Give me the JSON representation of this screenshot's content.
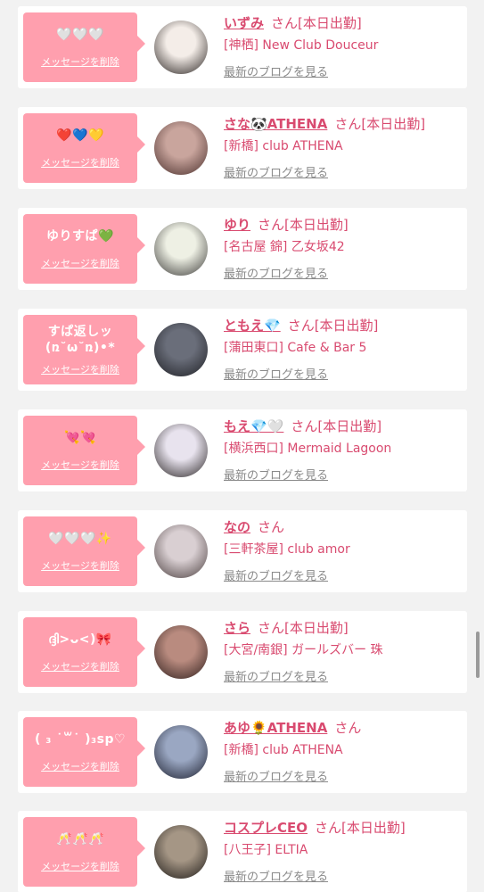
{
  "delete_label": "メッセージを削除",
  "blog_label": "最新のブログを見る",
  "san_label": "さん",
  "cards": [
    {
      "message": "🤍🤍🤍",
      "name": "いずみ",
      "status": "[本日出勤]",
      "shop": "[神栖] New Club Douceur"
    },
    {
      "message": "❤️💙💛",
      "name": "さな🐼ATHENA",
      "status": "[本日出勤]",
      "shop": "[新橋] club ATHENA"
    },
    {
      "message": "ゆりすぱ💚",
      "name": "ゆり",
      "status": "[本日出勤]",
      "shop": "[名古屋 錦] 乙女坂42"
    },
    {
      "message": "すぱ返しッ(ռ˘ω˘ռ)•*",
      "name": "ともえ💎",
      "status": "[本日出勤]",
      "shop": "[蒲田東口] Cafe & Bar 5"
    },
    {
      "message": "💘💘",
      "name": "もえ💎🤍",
      "status": "[本日出勤]",
      "shop": "[横浜西口] Mermaid Lagoon"
    },
    {
      "message": "🤍🤍🤍✨",
      "name": "なの",
      "status": "",
      "shop": "[三軒茶屋] club amor"
    },
    {
      "message": "ദ്ദി>ᴗ<)🎀",
      "name": "さら",
      "status": "[本日出勤]",
      "shop": "[大宮/南銀] ガールズバー 珠"
    },
    {
      "message": "( ₃ ˙꒳˙ )₃sp♡",
      "name": "あゆ🌻ATHENA",
      "status": "",
      "shop": "[新橋] club ATHENA"
    },
    {
      "message": "🥂🥂🥂",
      "name": "コスプレCEO",
      "status": "[本日出勤]",
      "shop": "[八王子] ELTIA"
    }
  ],
  "avatar_colors": [
    [
      "#f4ede8",
      "#2a2422"
    ],
    [
      "#c9a59d",
      "#4a2f2c"
    ],
    [
      "#eef0e4",
      "#3b3a38"
    ],
    [
      "#6a6e7a",
      "#1e1f24"
    ],
    [
      "#e8e3ee",
      "#2b2626"
    ],
    [
      "#d9cfd2",
      "#4b3f3f"
    ],
    [
      "#b98b7f",
      "#2e1e1c"
    ],
    [
      "#9aa7c2",
      "#1c1f2e"
    ],
    [
      "#a59685",
      "#1d1a17"
    ]
  ]
}
